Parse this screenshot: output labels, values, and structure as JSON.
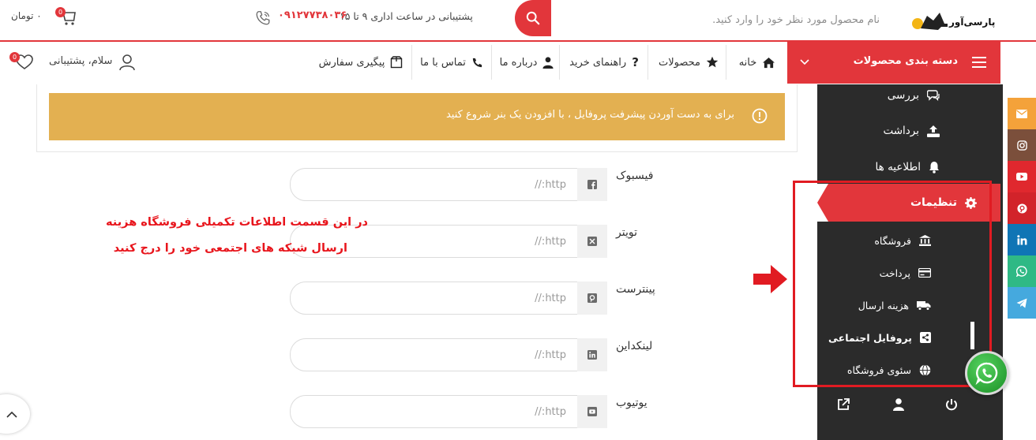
{
  "header": {
    "logo_text": "پارسی‌آور",
    "search": {
      "placeholder": "نام محصول مورد نظر خود را وارد کنید."
    },
    "support": {
      "text": "پشتیبانی در ساعت اداری ۹ تا ۱۵",
      "phone": "۰۹۱۲۷۷۳۸۰۳۶"
    },
    "cart": {
      "total": "۰ تومان",
      "count": "0"
    }
  },
  "nav": {
    "category_label": "دسته بندی محصولات",
    "items": [
      {
        "label": "خانه",
        "icon": "home-icon"
      },
      {
        "label": "محصولات",
        "icon": "star-icon"
      },
      {
        "label": "راهنمای خرید",
        "icon": "question-icon"
      },
      {
        "label": "درباره ما",
        "icon": "user-icon"
      },
      {
        "label": "تماس با ما",
        "icon": "phone-icon"
      },
      {
        "label": "پیگیری سفارش",
        "icon": "package-icon"
      }
    ],
    "user_greeting": "سلام، پشتیبانی",
    "wishlist_count": "0"
  },
  "alert": {
    "text": "برای به دست آوردن پیشرفت پروفایل ، با افزودن یک بنر شروع کنید"
  },
  "social_fields": [
    {
      "label": "فیسبوک",
      "icon": "facebook-icon",
      "placeholder": "http://"
    },
    {
      "label": "تویتر",
      "icon": "x-icon",
      "placeholder": "http://"
    },
    {
      "label": "پینترست",
      "icon": "pinterest-icon",
      "placeholder": "http://"
    },
    {
      "label": "لینکداین",
      "icon": "linkedin-icon",
      "placeholder": "http://"
    },
    {
      "label": "یوتیوب",
      "icon": "youtube-icon",
      "placeholder": "http://"
    }
  ],
  "annotation": {
    "line1": "در این قسمت اطلاعات تکمیلی فروشگاه هزینه",
    "line2": "ارسال شبکه های اجتمعی خود را درج کنید"
  },
  "sidebar": {
    "items": [
      {
        "label": "بررسی",
        "icon": "chat-icon"
      },
      {
        "label": "برداشت",
        "icon": "upload-icon"
      },
      {
        "label": "اطلاعیه ها",
        "icon": "bell-icon"
      }
    ],
    "settings": {
      "label": "تنظیمات",
      "icon": "gear-icon"
    },
    "sub_items": [
      {
        "label": "فروشگاه",
        "icon": "bank-icon"
      },
      {
        "label": "پرداخت",
        "icon": "card-icon"
      },
      {
        "label": "هزینه ارسال",
        "icon": "truck-icon"
      },
      {
        "label": "پروفایل اجتماعی",
        "icon": "share-icon",
        "active": true
      },
      {
        "label": "سئوی فروشگاه",
        "icon": "globe-icon"
      }
    ],
    "bottom_icons": [
      "external-link-icon",
      "user-icon",
      "power-icon"
    ]
  },
  "social_bar": [
    {
      "name": "email",
      "color": "#f4a23a"
    },
    {
      "name": "instagram",
      "color": "#7b4f3b"
    },
    {
      "name": "youtube",
      "color": "#e0282e"
    },
    {
      "name": "pinterest",
      "color": "#d2232a"
    },
    {
      "name": "linkedin",
      "color": "#0f75b5"
    },
    {
      "name": "whatsapp",
      "color": "#2fb985"
    },
    {
      "name": "telegram",
      "color": "#45a9de"
    }
  ],
  "colors": {
    "accent": "#e2363b",
    "alert": "#e3b051",
    "sidebar": "#2b2b2b",
    "annotation": "#e8151c"
  }
}
